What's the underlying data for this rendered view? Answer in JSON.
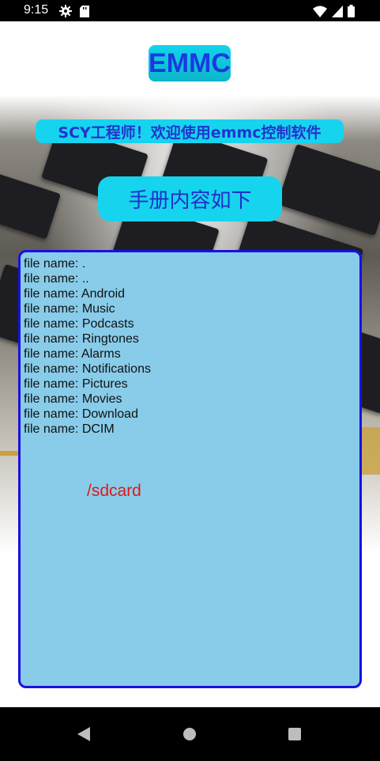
{
  "status_bar": {
    "time": "9:15",
    "icons": [
      "settings-icon",
      "sd-card-icon",
      "wifi-icon",
      "signal-icon",
      "battery-icon"
    ]
  },
  "header": {
    "title": "EMMC"
  },
  "welcome": {
    "text": "SCY工程师！欢迎使用emmc控制软件"
  },
  "manual_button": {
    "label": "手册内容如下"
  },
  "file_panel": {
    "files": [
      "file name: .",
      "file name: ..",
      "file name: Android",
      "file name: Music",
      "file name: Podcasts",
      "file name: Ringtones",
      "file name: Alarms",
      "file name: Notifications",
      "file name: Pictures",
      "file name: Movies",
      "file name: Download",
      "file name: DCIM"
    ],
    "path": "/sdcard"
  },
  "nav_bar": {
    "buttons": [
      "back-icon",
      "home-icon",
      "recents-icon"
    ]
  },
  "colors": {
    "accent_cyan": "#16d4ee",
    "title_text": "#1a3ae0",
    "panel_bg": "#88ccea",
    "panel_border": "#1a10e0",
    "path_red": "#e01818"
  }
}
